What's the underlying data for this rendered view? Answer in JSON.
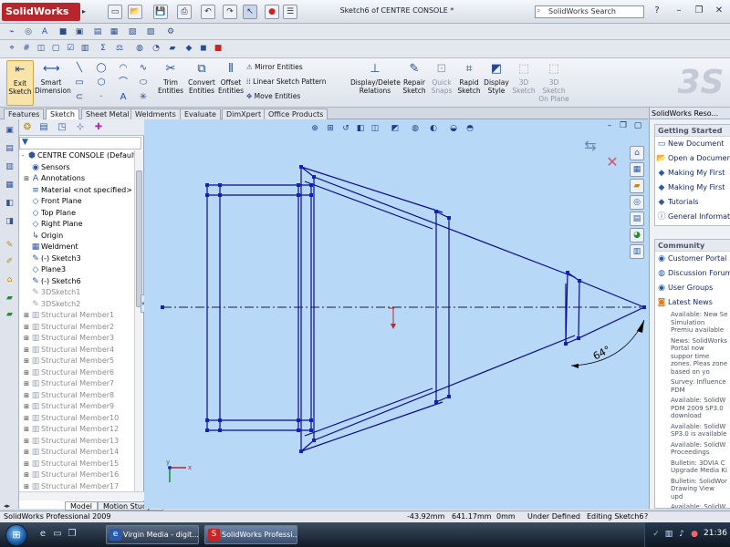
{
  "app": {
    "logo_text": "SolidWorks",
    "window_title": "Sketch6 of CENTRE CONSOLE *",
    "search_placeholder": "SolidWorks Search",
    "window_controls": [
      "minimize-icon",
      "restore-icon",
      "close-icon"
    ]
  },
  "command_manager": {
    "exit_sketch": "Exit Sketch",
    "smart_dimension": "Smart Dimension",
    "trim_entities": "Trim Entities",
    "convert_entities": "Convert Entities",
    "offset_entities": "Offset Entities",
    "mirror_entities": "Mirror Entities",
    "linear_sketch_pattern": "Linear Sketch Pattern",
    "move_entities": "Move Entities",
    "display_delete_relations": "Display/Delete Relations",
    "repair_sketch": "Repair Sketch",
    "quick_snaps": "Quick Snaps",
    "rapid_sketch": "Rapid Sketch",
    "display_style": "Display Style",
    "sketch_3d": "3D Sketch",
    "sketch_3d_on_plane": "3D Sketch On Plane"
  },
  "tabs": [
    "Features",
    "Sketch",
    "Sheet Metal",
    "Weldments",
    "Evaluate",
    "DimXpert",
    "Office Products"
  ],
  "active_tab": "Sketch",
  "feature_tree": {
    "root": "CENTRE CONSOLE  (Default<...",
    "items": [
      {
        "label": "Sensors",
        "expand": "",
        "icon": "sensor-icon",
        "gray": false
      },
      {
        "label": "Annotations",
        "expand": "+",
        "icon": "annotation-icon",
        "gray": false
      },
      {
        "label": "Material <not specified>",
        "expand": "",
        "icon": "material-icon",
        "gray": false
      },
      {
        "label": "Front Plane",
        "expand": "",
        "icon": "plane-icon",
        "gray": false
      },
      {
        "label": "Top Plane",
        "expand": "",
        "icon": "plane-icon",
        "gray": false
      },
      {
        "label": "Right Plane",
        "expand": "",
        "icon": "plane-icon",
        "gray": false
      },
      {
        "label": "Origin",
        "expand": "",
        "icon": "origin-icon",
        "gray": false
      },
      {
        "label": "Weldment",
        "expand": "",
        "icon": "weldment-icon",
        "gray": false
      },
      {
        "label": "(-) Sketch3",
        "expand": "",
        "icon": "sketch-icon",
        "gray": false
      },
      {
        "label": "Plane3",
        "expand": "",
        "icon": "plane-icon",
        "gray": false
      },
      {
        "label": "(-) Sketch6",
        "expand": "",
        "icon": "sketch-icon",
        "gray": false
      },
      {
        "label": "3DSketch1",
        "expand": "",
        "icon": "sketch3d-icon",
        "gray": true
      },
      {
        "label": "3DSketch2",
        "expand": "",
        "icon": "sketch3d-icon",
        "gray": true
      },
      {
        "label": "Structural Member1",
        "expand": "+",
        "icon": "structural-member-icon",
        "gray": true
      },
      {
        "label": "Structural Member2",
        "expand": "+",
        "icon": "structural-member-icon",
        "gray": true
      },
      {
        "label": "Structural Member3",
        "expand": "+",
        "icon": "structural-member-icon",
        "gray": true
      },
      {
        "label": "Structural Member4",
        "expand": "+",
        "icon": "structural-member-icon",
        "gray": true
      },
      {
        "label": "Structural Member5",
        "expand": "+",
        "icon": "structural-member-icon",
        "gray": true
      },
      {
        "label": "Structural Member6",
        "expand": "+",
        "icon": "structural-member-icon",
        "gray": true
      },
      {
        "label": "Structural Member7",
        "expand": "+",
        "icon": "structural-member-icon",
        "gray": true
      },
      {
        "label": "Structural Member8",
        "expand": "+",
        "icon": "structural-member-icon",
        "gray": true
      },
      {
        "label": "Structural Member9",
        "expand": "+",
        "icon": "structural-member-icon",
        "gray": true
      },
      {
        "label": "Structural Member10",
        "expand": "+",
        "icon": "structural-member-icon",
        "gray": true
      },
      {
        "label": "Structural Member12",
        "expand": "+",
        "icon": "structural-member-icon",
        "gray": true
      },
      {
        "label": "Structural Member13",
        "expand": "+",
        "icon": "structural-member-icon",
        "gray": true
      },
      {
        "label": "Structural Member14",
        "expand": "+",
        "icon": "structural-member-icon",
        "gray": true
      },
      {
        "label": "Structural Member15",
        "expand": "+",
        "icon": "structural-member-icon",
        "gray": true
      },
      {
        "label": "Structural Member16",
        "expand": "+",
        "icon": "structural-member-icon",
        "gray": true
      },
      {
        "label": "Structural Member17",
        "expand": "+",
        "icon": "structural-member-icon",
        "gray": true
      }
    ]
  },
  "model_tabs": [
    "Model",
    "Motion Study 1"
  ],
  "sketch": {
    "angle_dimension": "64°",
    "line_color": "#0a0a8c",
    "point_color": "#1020c8",
    "background_color": "#b8d8f7"
  },
  "task_pane": {
    "title": "SolidWorks Reso...",
    "getting_started": {
      "title": "Getting Started",
      "links": [
        "New Document",
        "Open a Document",
        "Making My First",
        "Making My First",
        "Tutorials",
        "General Information"
      ]
    },
    "community": {
      "title": "Community",
      "links": [
        "Customer Portal",
        "Discussion Forum",
        "User Groups",
        "Latest News"
      ],
      "news": [
        "Available: New Se Simulation Premiu available",
        "News: SolidWorks Portal now suppor time zones. Pleas zone based on yo",
        "Survey: Influence PDM",
        "Available: SolidW PDM 2009 SP3.0 download",
        "Available: SolidW SP3.0 is available",
        "Available: SolidW Proceedings",
        "Bulletin: 3DVIA C Upgrade Media Ki",
        "Bulletin: SolidWor Drawing View upd",
        "Available: SolidW"
      ]
    }
  },
  "status_bar": {
    "product": "SolidWorks Professional 2009",
    "x": "-43.92mm",
    "y": "641.17mm",
    "z": "0mm",
    "state": "Under Defined",
    "editing": "Editing Sketch6"
  },
  "taskbar": {
    "start": "Start",
    "tasks": [
      {
        "label": "Virgin Media - digit...",
        "active": false
      },
      {
        "label": "SolidWorks Professi...",
        "active": true
      }
    ],
    "clock": "21:36"
  }
}
